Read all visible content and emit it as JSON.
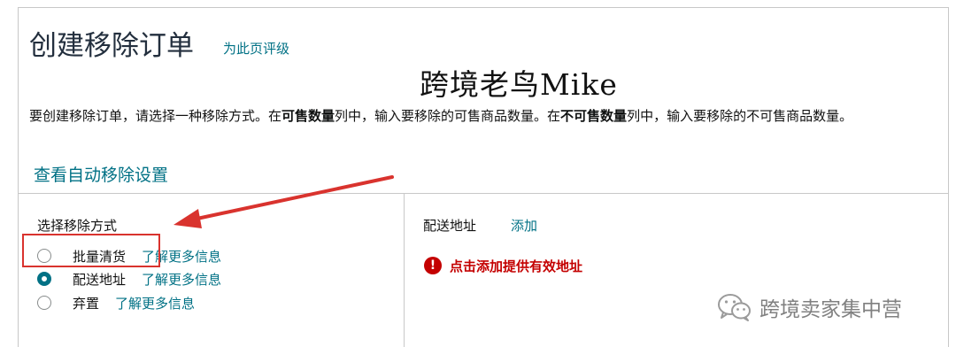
{
  "header": {
    "title": "创建移除订单",
    "rate_link": "为此页评级"
  },
  "watermark_top": "跨境老鸟Mike",
  "instructions": {
    "part1": "要创建移除订单，请选择一种移除方式。在",
    "bold1": "可售数量",
    "part2": "列中，输入要移除的可售商品数量。在",
    "bold2": "不可售数量",
    "part3": "列中，输入要移除的不可售商品数量。"
  },
  "auto_removal_link": "查看自动移除设置",
  "removal_method": {
    "label": "选择移除方式",
    "options": [
      {
        "label": "批量清货",
        "learn_more": "了解更多信息",
        "selected": false
      },
      {
        "label": "配送地址",
        "learn_more": "了解更多信息",
        "selected": true
      },
      {
        "label": "弃置",
        "learn_more": "了解更多信息",
        "selected": false
      }
    ]
  },
  "shipping_address": {
    "label": "配送地址",
    "add_link": "添加",
    "error_icon_name": "exclamation-icon",
    "error": "点击添加提供有效地址"
  },
  "annotation": {
    "color": "#d9332e"
  },
  "wechat_watermark": {
    "icon_name": "wechat-icon",
    "text": "跨境卖家集中营"
  },
  "colors": {
    "link": "#007185",
    "error": "#c40000",
    "title": "#232f3e"
  }
}
